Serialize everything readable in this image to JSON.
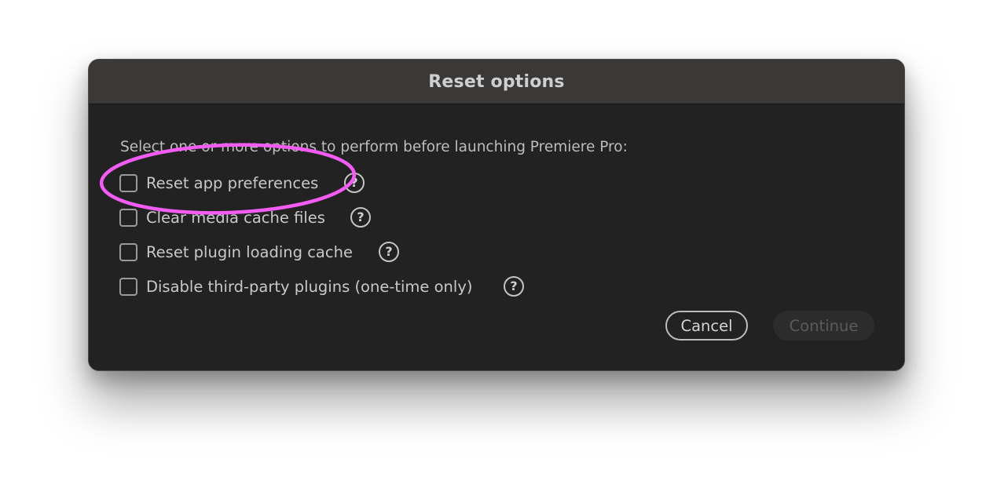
{
  "dialog": {
    "title": "Reset options",
    "instructions": "Select one or more options to perform before launching Premiere Pro:",
    "options": [
      {
        "label": "Reset app preferences",
        "checked": false,
        "help_icon": "question-circle-icon"
      },
      {
        "label": "Clear media cache files",
        "checked": false,
        "help_icon": "question-circle-icon"
      },
      {
        "label": "Reset plugin loading cache",
        "checked": false,
        "help_icon": "question-circle-icon"
      },
      {
        "label": "Disable third-party plugins (one-time only)",
        "checked": false,
        "help_icon": "question-circle-icon"
      }
    ],
    "help_glyph": "?",
    "buttons": {
      "cancel_label": "Cancel",
      "continue_label": "Continue",
      "continue_enabled": false
    }
  },
  "colors": {
    "dialog_background": "#222222",
    "titlebar_background": "#3a3938",
    "annotation_highlight": "#f25cf2"
  }
}
